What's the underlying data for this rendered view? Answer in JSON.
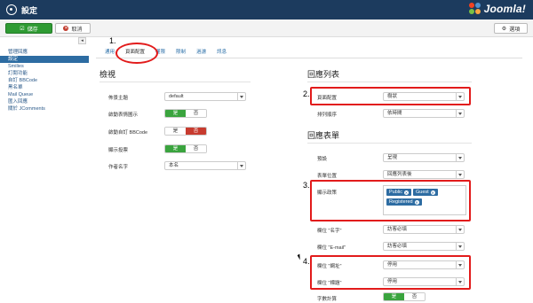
{
  "header": {
    "title": "設定",
    "brand": "Joomla!",
    "brand_colors": [
      "#f44321",
      "#5091cd",
      "#f9a541",
      "#7ac143"
    ]
  },
  "toolbar": {
    "save_label": "儲存",
    "cancel_label": "取消",
    "options_label": "選項"
  },
  "sidebar": {
    "items": [
      {
        "label": "管理回應",
        "active": false
      },
      {
        "label": "設定",
        "active": true
      },
      {
        "label": "Smilies",
        "active": false
      },
      {
        "label": "訂閱功能",
        "active": false
      },
      {
        "label": "自訂 BBCode",
        "active": false
      },
      {
        "label": "黑名單",
        "active": false
      },
      {
        "label": "Mail Queue",
        "active": false
      },
      {
        "label": "匯入回應",
        "active": false
      },
      {
        "label": "關於 JComments",
        "active": false
      }
    ]
  },
  "tabs": [
    "通用",
    "頁面配置",
    "權限",
    "限制",
    "過濾",
    "訊息"
  ],
  "active_tab": "頁面配置",
  "left": {
    "section_title": "檢視",
    "rows": [
      {
        "label": "佈景主題",
        "value": "default"
      },
      {
        "label": "啟動表情圖示",
        "on": "是",
        "off": "否"
      },
      {
        "label": "啟動自訂 BBCode",
        "on": "是",
        "off": "否"
      },
      {
        "label": "顯示投票",
        "on": "是",
        "off": "否"
      },
      {
        "label": "作者名字",
        "value": "本名"
      }
    ]
  },
  "right": {
    "list_title": "回應列表",
    "list_rows": [
      {
        "label": "頁面配置",
        "value": "樹狀"
      },
      {
        "label": "排列順序",
        "value": "依時間"
      }
    ],
    "form_title": "回應表單",
    "form_rows": [
      {
        "label": "預設",
        "value": "呈現"
      },
      {
        "label": "表單位置",
        "value": "回應列表後"
      },
      {
        "label": "顯示政策",
        "chips": [
          "Public",
          "Guest",
          "Registered"
        ]
      },
      {
        "label": "欄位 \"名字\"",
        "value": "訪客必填"
      },
      {
        "label": "欄位 \"E-mail\"",
        "value": "訪客必填"
      },
      {
        "label": "欄位 \"網址\"",
        "value": "停用"
      },
      {
        "label": "欄位 \"標題\"",
        "value": "停用"
      },
      {
        "label": "字數計算",
        "on": "是",
        "off": "否"
      }
    ]
  },
  "annotations": [
    "1.",
    "2.",
    "3.",
    "4."
  ]
}
